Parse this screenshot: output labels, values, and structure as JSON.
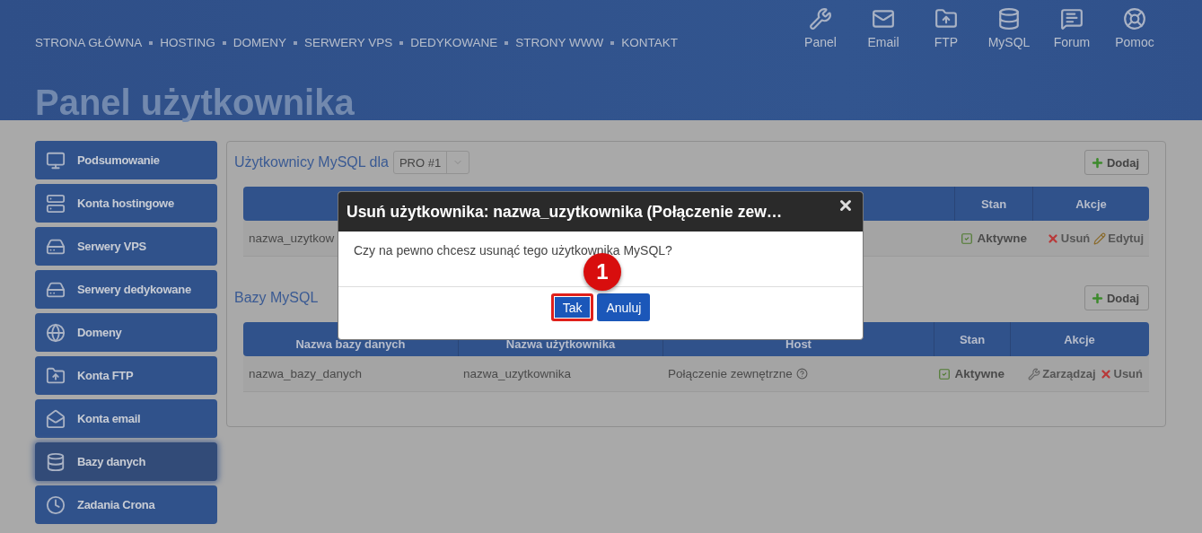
{
  "header": {
    "nav": [
      "STRONA GŁÓWNA",
      "HOSTING",
      "DOMENY",
      "SERWERY VPS",
      "DEDYKOWANE",
      "STRONY WWW",
      "KONTAKT"
    ],
    "quick_links": [
      "Panel",
      "Email",
      "FTP",
      "MySQL",
      "Forum",
      "Pomoc"
    ],
    "page_title": "Panel użytkownika"
  },
  "sidebar": {
    "items": [
      {
        "label": "Podsumowanie",
        "selected": false
      },
      {
        "label": "Konta hostingowe",
        "selected": false
      },
      {
        "label": "Serwery VPS",
        "selected": false
      },
      {
        "label": "Serwery dedykowane",
        "selected": false
      },
      {
        "label": "Domeny",
        "selected": false
      },
      {
        "label": "Konta FTP",
        "selected": false
      },
      {
        "label": "Konta email",
        "selected": false
      },
      {
        "label": "Bazy danych",
        "selected": true
      },
      {
        "label": "Zadania Crona",
        "selected": false
      }
    ]
  },
  "mysql_users": {
    "title": "Użytkownicy MySQL dla",
    "account_select": "PRO #1",
    "add_button": "Dodaj",
    "columns": [
      "Stan",
      "Akcje"
    ],
    "rows": [
      {
        "user": "nazwa_uzytkow",
        "status": "Aktywne",
        "actions": [
          {
            "kind": "delete",
            "label": "Usuń"
          },
          {
            "kind": "edit",
            "label": "Edytuj"
          }
        ]
      }
    ]
  },
  "databases": {
    "title": "Bazy MySQL",
    "add_button": "Dodaj",
    "columns": [
      "Nazwa bazy danych",
      "Nazwa użytkownika",
      "Host",
      "Stan",
      "Akcje"
    ],
    "rows": [
      {
        "name": "nazwa_bazy_danych",
        "user": "nazwa_uzytkownika",
        "host": "Połączenie zewnętrzne",
        "status": "Aktywne",
        "actions": [
          {
            "kind": "manage",
            "label": "Zarządzaj"
          },
          {
            "kind": "delete",
            "label": "Usuń"
          }
        ]
      }
    ]
  },
  "dialog": {
    "title": "Usuń użytkownika: nazwa_uzytkownika (Połączenie zew…",
    "message": "Czy na pewno chcesz usunąć tego użytkownika MySQL?",
    "buttons": [
      {
        "label": "Tak",
        "highlighted": true
      },
      {
        "label": "Anuluj",
        "highlighted": false
      }
    ],
    "step_badge": "1"
  }
}
